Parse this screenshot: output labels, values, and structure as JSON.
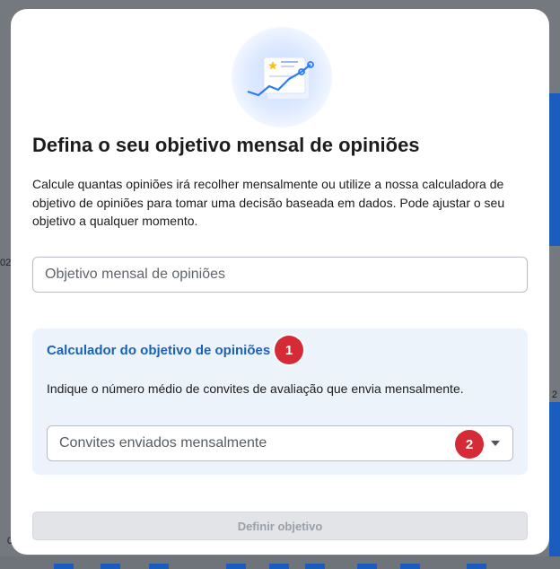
{
  "background": {
    "edge_left_text": "02",
    "edge_right_text": "2",
    "edge_bottom_left_text": "0"
  },
  "modal": {
    "title": "Defina o seu objetivo mensal de opiniões",
    "description": "Calcule quantas opiniões irá recolher mensalmente ou utilize a nossa calculadora de objetivo de opiniões para tomar uma decisão baseada em dados. Pode ajustar o seu objetivo a qualquer momento.",
    "goal_input": {
      "placeholder": "Objetivo mensal de opiniões",
      "value": ""
    },
    "calculator": {
      "title": "Calculador do objetivo de opiniões",
      "description": "Indique o número médio de convites de avaliação que envia mensalmente.",
      "select": {
        "selected": "Convites enviados mensalmente",
        "icon": "chevron-down-icon"
      }
    },
    "markers": [
      "1",
      "2"
    ],
    "submit_label": "Definir objetivo",
    "hero_icon": "growth-chart-illustration"
  },
  "colors": {
    "accent": "#1962b5",
    "marker": "#d42b36",
    "disabled_button": "#e2e4e7",
    "calculator_bg": "#edf3fb"
  }
}
